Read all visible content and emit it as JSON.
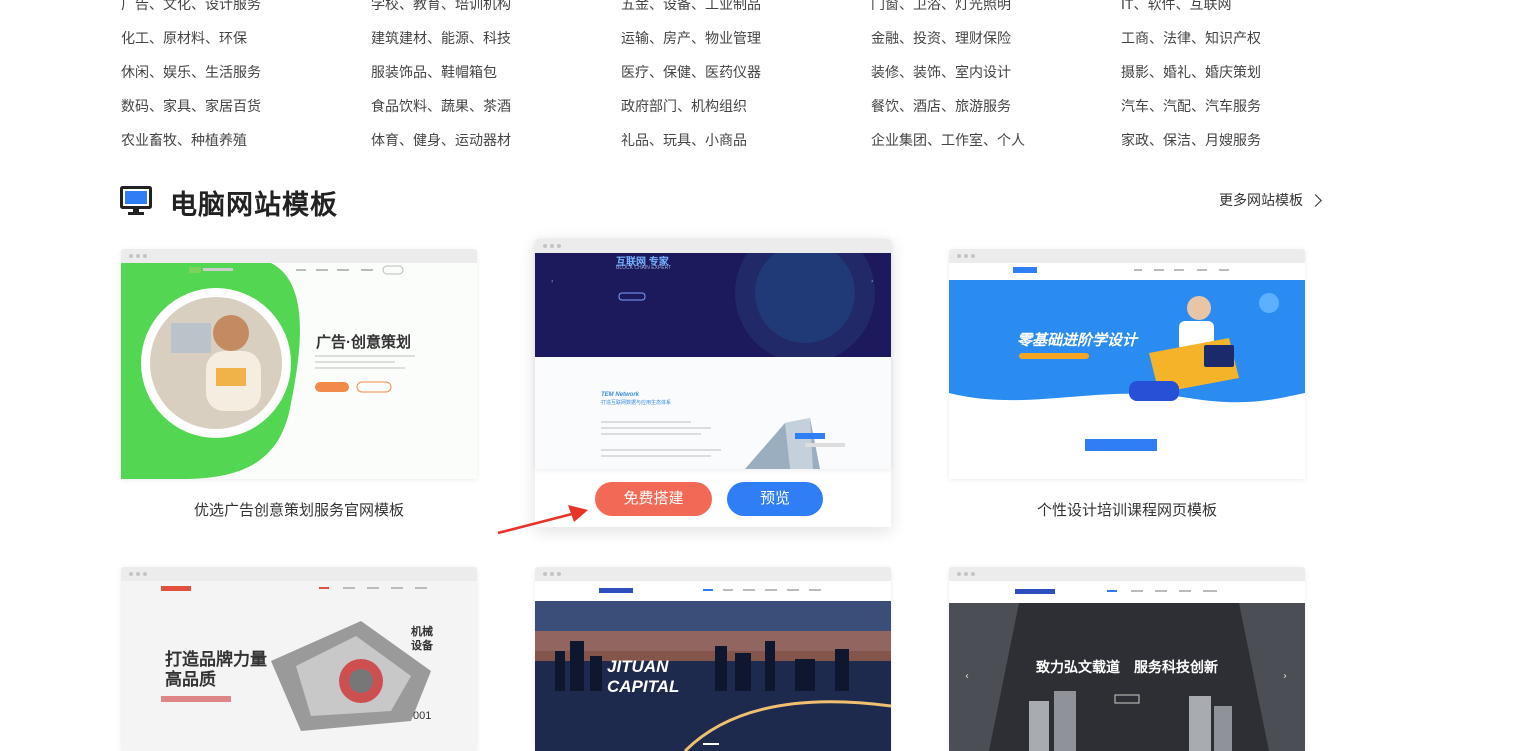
{
  "categories": [
    [
      "广告、文化、设计服务",
      "学校、教育、培训机构",
      "五金、设备、工业制品",
      "门窗、卫浴、灯光照明",
      "IT、软件、互联网"
    ],
    [
      "化工、原材料、环保",
      "建筑建材、能源、科技",
      "运输、房产、物业管理",
      "金融、投资、理财保险",
      "工商、法律、知识产权"
    ],
    [
      "休闲、娱乐、生活服务",
      "服装饰品、鞋帽箱包",
      "医疗、保健、医药仪器",
      "装修、装饰、室内设计",
      "摄影、婚礼、婚庆策划"
    ],
    [
      "数码、家具、家居百货",
      "食品饮料、蔬果、茶酒",
      "政府部门、机构组织",
      "餐饮、酒店、旅游服务",
      "汽车、汽配、汽车服务"
    ],
    [
      "农业畜牧、种植养殖",
      "体育、健身、运动器材",
      "礼品、玩具、小商品",
      "企业集团、工作室、个人",
      "家政、保洁、月嫂服务"
    ]
  ],
  "section": {
    "title": "电脑网站模板",
    "more": "更多网站模板"
  },
  "cards": [
    {
      "label": "优选广告创意策划服务官网模板",
      "thumb_title": "广告·创意策划"
    },
    {
      "label": "",
      "thumb_title": "互联网 专家",
      "thumb_sub": "BLOCK CHAIN EXPERT",
      "thumb_h2": "TEM Network",
      "thumb_h3": "打造互联网数据与应用生态体系"
    },
    {
      "label": "个性设计培训课程网页模板",
      "thumb_title": "零基础进阶学设计"
    },
    {
      "label": "",
      "thumb_title": "打造品牌力量",
      "thumb_title2": "高品质",
      "thumb_side": "机械设备",
      "thumb_num": "001"
    },
    {
      "label": "",
      "thumb_title": "JITUAN",
      "thumb_title2": "CAPITAL"
    },
    {
      "label": "",
      "thumb_title": "致力弘文载道　服务科技创新"
    }
  ],
  "buttons": {
    "build": "免费搭建",
    "preview": "预览"
  },
  "colors": {
    "build": "#f26a55",
    "preview": "#2f7ef5",
    "arrow": "#e8322a"
  }
}
